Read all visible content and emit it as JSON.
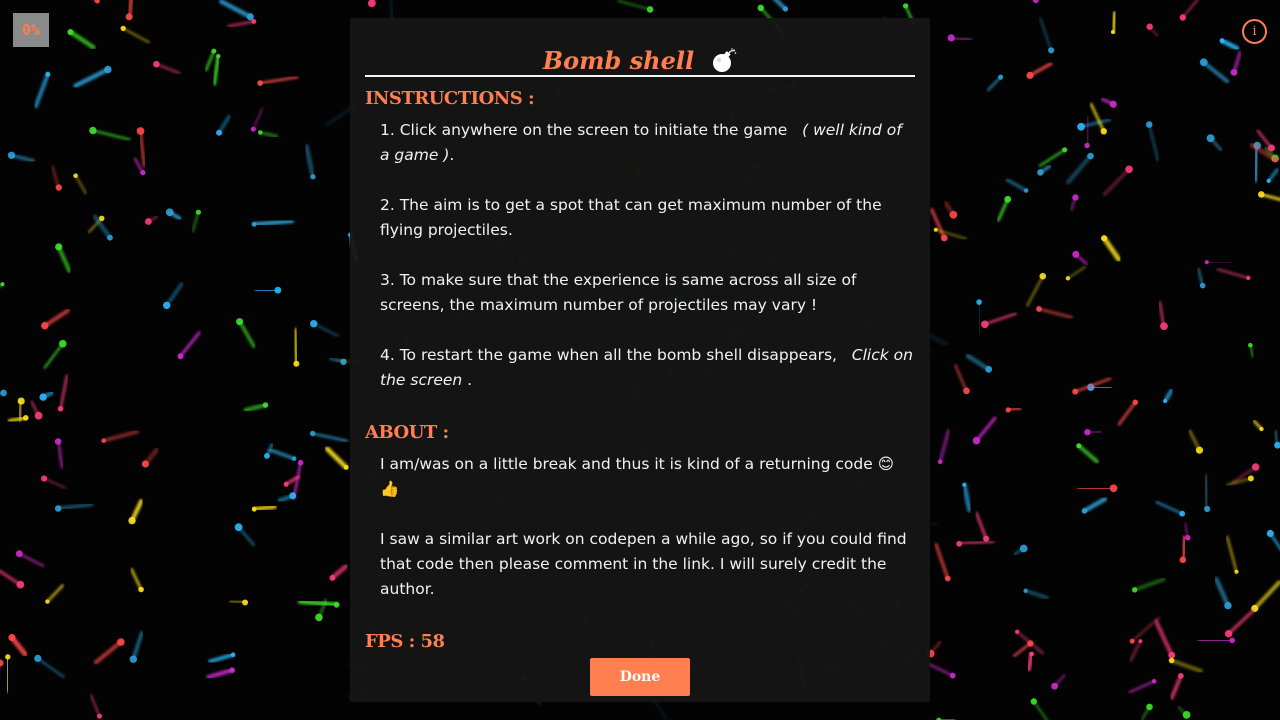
{
  "progress_badge": {
    "text": "0%"
  },
  "info_button": {
    "icon": "info-icon",
    "glyph": "i"
  },
  "modal": {
    "title": "Bomb shell",
    "title_icon": "bomb-icon",
    "instructions": {
      "heading": "INSTRUCTIONS :",
      "items": [
        {
          "text": "1. Click anywhere on the screen to initiate the game",
          "emphasis": "( well kind of a game )",
          "suffix": "."
        },
        {
          "text": "2. The aim is to get a spot that can get maximum number of the flying projectiles."
        },
        {
          "text": "3. To make sure that the experience is same across all size of screens, the maximum number of projectiles may vary !"
        },
        {
          "text": "4. To restart the game when all the bomb shell disappears,",
          "emphasis": "Click on the screen",
          "suffix": " ."
        }
      ]
    },
    "about": {
      "heading": "ABOUT :",
      "items": [
        {
          "text": "I am/was on a little break and thus it is kind of a returning code 😊 👍"
        },
        {
          "text": "I saw a similar art work on codepen a while ago, so if you could find that code then please comment in the link. I will surely credit the author."
        }
      ]
    },
    "fps": "FPS : 58",
    "done_label": "Done"
  },
  "colors": {
    "accent": "#ff7f50",
    "background": "#030303",
    "modal_bg": "#161616",
    "text": "#f2f2f2",
    "projectiles": [
      "#ff3d7f",
      "#d02bd0",
      "#ffe21a",
      "#3fe22c",
      "#2fa0d8",
      "#ff4a4a",
      "#2bb8ff"
    ]
  }
}
